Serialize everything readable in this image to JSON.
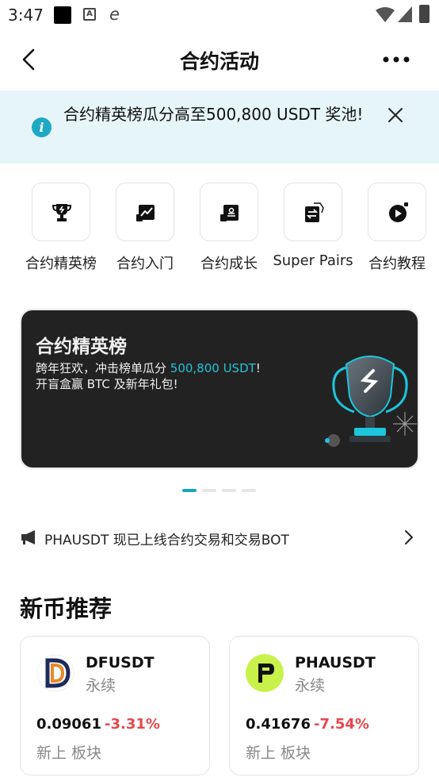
{
  "status_bar": {
    "time": "3:47"
  },
  "header": {
    "title": "合约活动"
  },
  "notice": {
    "text": "合约精英榜瓜分高至500,800 USDT 奖池!"
  },
  "quick_entries": [
    {
      "label": "合约精英榜",
      "icon": "trophy-icon"
    },
    {
      "label": "合约入门",
      "icon": "chart-icon"
    },
    {
      "label": "合约成长",
      "icon": "growth-icon"
    },
    {
      "label": "Super Pairs",
      "icon": "swap-icon"
    },
    {
      "label": "合约教程",
      "icon": "play-icon"
    }
  ],
  "promo": {
    "title": "合约精英榜",
    "line1_prefix": "跨年狂欢，冲击榜单瓜分 ",
    "line1_highlight": "500,800 USDT",
    "line1_suffix": "!",
    "line2": "开盲盒赢 BTC 及新年礼包!"
  },
  "carousel": {
    "count": 4,
    "active": 0
  },
  "announcement": {
    "text": "PHAUSDT 现已上线合约交易和交易BOT"
  },
  "new_coins": {
    "title": "新币推荐",
    "items": [
      {
        "name": "DFUSDT",
        "type": "永续",
        "price": "0.09061",
        "change": "-3.31%",
        "tags": "新上 板块"
      },
      {
        "name": "PHAUSDT",
        "type": "永续",
        "price": "0.41676",
        "change": "-7.54%",
        "tags": "新上 板块"
      }
    ]
  },
  "colors": {
    "accent": "#1aa3bd",
    "down": "#e5484d",
    "notice_bg": "#e6f5f9",
    "promo_bg": "#222222"
  }
}
